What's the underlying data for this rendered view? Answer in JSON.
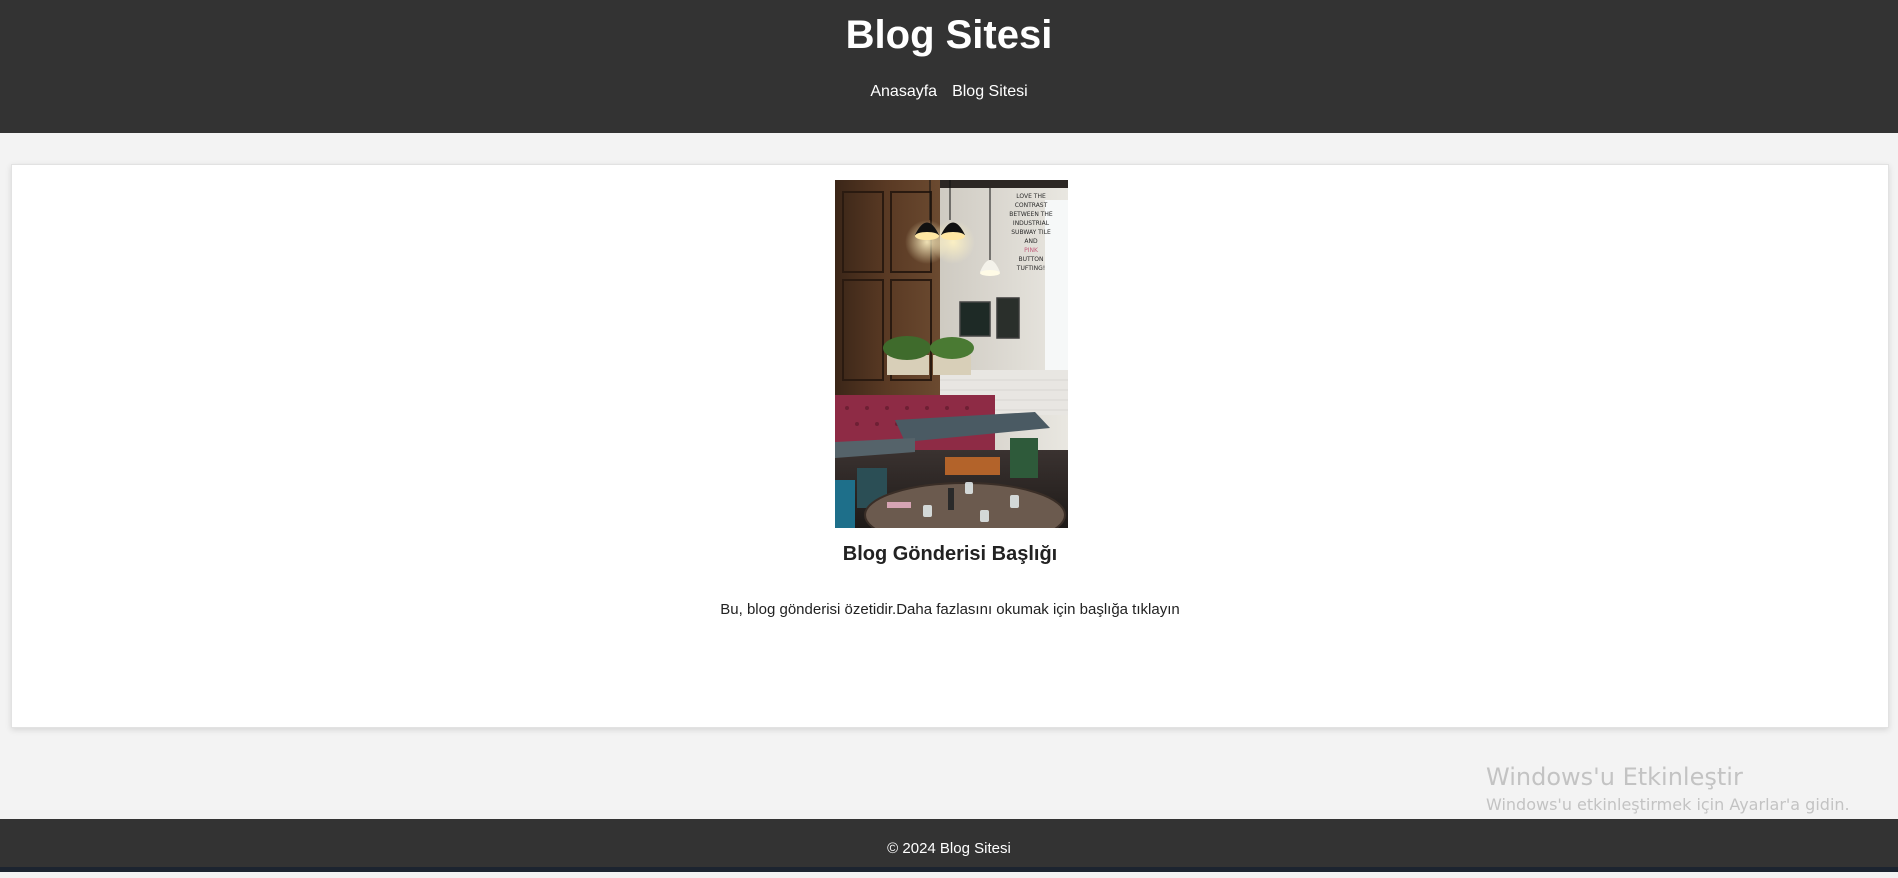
{
  "header": {
    "title": "Blog Sitesi",
    "nav": [
      {
        "label": "Anasayfa"
      },
      {
        "label": "Blog Sitesi"
      }
    ]
  },
  "post": {
    "image_alt": "restaurant-interior-photo",
    "image_text": [
      "LOVE THE",
      "CONTRAST",
      "BETWEEN THE",
      "INDUSTRIAL",
      "SUBWAY TILE",
      "AND",
      "PINK",
      "BUTTON",
      "TUFTING!"
    ],
    "title": "Blog Gönderisi Başlığı",
    "excerpt": "Bu, blog gönderisi özetidir.Daha fazlasını okumak için başlığa tıklayın"
  },
  "footer": {
    "copyright": "© 2024 Blog Sitesi"
  },
  "watermark": {
    "title": "Windows'u Etkinleştir",
    "subtitle": "Windows'u etkinleştirmek için Ayarlar'a gidin."
  },
  "colors": {
    "header_bg": "#333333",
    "page_bg": "#f3f3f3",
    "card_bg": "#ffffff"
  }
}
